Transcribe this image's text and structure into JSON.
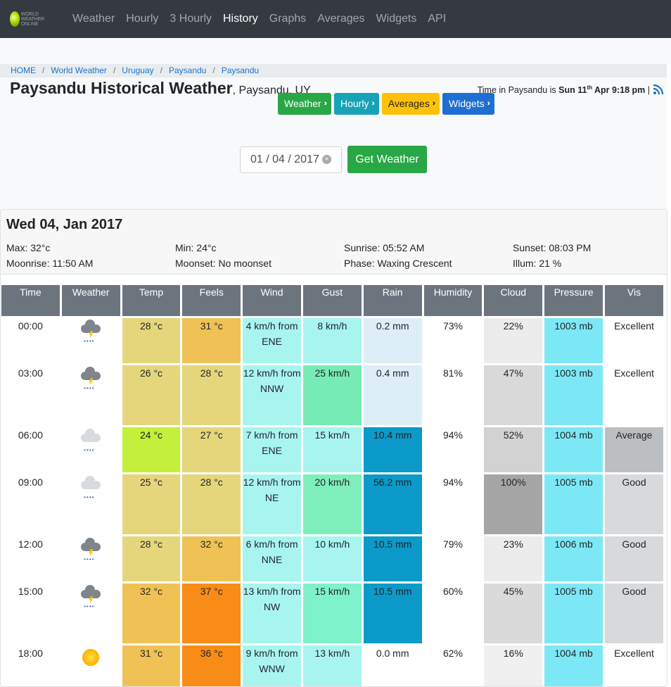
{
  "nav": {
    "logo_text": "WORLD WEATHER ONLINE",
    "items": [
      "Weather",
      "Hourly",
      "3 Hourly",
      "History",
      "Graphs",
      "Averages",
      "Widgets",
      "API"
    ],
    "active": "History"
  },
  "breadcrumb": [
    "HOME",
    "World Weather",
    "Uruguay",
    "Paysandu",
    "Paysandu"
  ],
  "header": {
    "title": "Paysandu Historical Weather",
    "subtitle": ", Paysandu, UY",
    "time_prefix": "Time in Paysandu is ",
    "time_day": "Sun 11",
    "time_suffix_sup": "th",
    "time_rest": " Apr 9:18 pm",
    "time_pipe": " |"
  },
  "buttons": [
    "Weather",
    "Hourly",
    "Averages",
    "Widgets"
  ],
  "date_input": {
    "value": "01 / 04 / 2017"
  },
  "get_weather_label": "Get Weather",
  "day": {
    "title": "Wed 04, Jan 2017",
    "max": "Max: 32°c",
    "min": "Min: 24°c",
    "sunrise": "Sunrise: 05:52 AM",
    "sunset": "Sunset: 08:03 PM",
    "moonrise": "Moonrise: 11:50 AM",
    "moonset": "Moonset: No moonset",
    "phase": "Phase: Waxing Crescent",
    "illum": "Illum: 21 %"
  },
  "columns": [
    "Time",
    "Weather",
    "Temp",
    "Feels",
    "Wind",
    "Gust",
    "Rain",
    "Humidity",
    "Cloud",
    "Pressure",
    "Vis"
  ],
  "rows": [
    {
      "time": "00:00",
      "icon": "thunder-rain-icon",
      "temp": "28 °c",
      "feels": "31 °c",
      "wind": "4 km/h from ENE",
      "gust": "8 km/h",
      "rain": "0.2 mm",
      "humidity": "73%",
      "cloud": "22%",
      "pressure": "1003 mb",
      "vis": "Excellent",
      "temp_color": "#e5d67c",
      "feels_color": "#f0c255",
      "wind_color": "#a8f5f0",
      "gust_color": "#a8f5f0",
      "rain_color": "#ddeef7",
      "cloud_color": "#ececec",
      "vis_color": "#ffffff"
    },
    {
      "time": "03:00",
      "icon": "thunder-rain-icon",
      "temp": "26 °c",
      "feels": "28 °c",
      "wind": "12 km/h from NNW",
      "gust": "25 km/h",
      "rain": "0.4 mm",
      "humidity": "81%",
      "cloud": "47%",
      "pressure": "1003 mb",
      "vis": "Excellent",
      "temp_color": "#e5d67c",
      "feels_color": "#e5d67c",
      "wind_color": "#a8f5f0",
      "gust_color": "#76ecb4",
      "rain_color": "#ddeef7",
      "cloud_color": "#d9d9d9",
      "vis_color": "#ffffff"
    },
    {
      "time": "06:00",
      "icon": "heavy-rain-icon",
      "temp": "24 °c",
      "feels": "27 °c",
      "wind": "7 km/h from ENE",
      "gust": "15 km/h",
      "rain": "10.4 mm",
      "humidity": "94%",
      "cloud": "52%",
      "pressure": "1004 mb",
      "vis": "Average",
      "temp_color": "#c4ef3a",
      "feels_color": "#e5d67c",
      "wind_color": "#a8f5f0",
      "gust_color": "#a8f5f0",
      "rain_color": "#0b9ac9",
      "cloud_color": "#d2d2d2",
      "vis_color": "#bcbfc1"
    },
    {
      "time": "09:00",
      "icon": "heavy-rain-icon",
      "temp": "25 °c",
      "feels": "28 °c",
      "wind": "12 km/h from NE",
      "gust": "20 km/h",
      "rain": "56.2 mm",
      "humidity": "94%",
      "cloud": "100%",
      "pressure": "1005 mb",
      "vis": "Good",
      "temp_color": "#e5d67c",
      "feels_color": "#e5d67c",
      "wind_color": "#a8f5f0",
      "gust_color": "#7eefba",
      "rain_color": "#0b9ac9",
      "cloud_color": "#a5a5a5",
      "vis_color": "#d8d9da"
    },
    {
      "time": "12:00",
      "icon": "thunder-rain-icon",
      "temp": "28 °c",
      "feels": "32 °c",
      "wind": "6 km/h from NNE",
      "gust": "10 km/h",
      "rain": "10.5 mm",
      "humidity": "79%",
      "cloud": "23%",
      "pressure": "1006 mb",
      "vis": "Good",
      "temp_color": "#e5d67c",
      "feels_color": "#f0c255",
      "wind_color": "#a8f5f0",
      "gust_color": "#a8f5f0",
      "rain_color": "#0b9ac9",
      "cloud_color": "#ececec",
      "vis_color": "#d8d9da"
    },
    {
      "time": "15:00",
      "icon": "thunder-rain-icon",
      "temp": "32 °c",
      "feels": "37 °c",
      "wind": "13 km/h from NW",
      "gust": "15 km/h",
      "rain": "10.5 mm",
      "humidity": "60%",
      "cloud": "45%",
      "pressure": "1005 mb",
      "vis": "Good",
      "temp_color": "#f0c255",
      "feels_color": "#f98c16",
      "wind_color": "#a8f5f0",
      "gust_color": "#7ef2ca",
      "rain_color": "#0b9ac9",
      "cloud_color": "#dadada",
      "vis_color": "#d8d9da"
    },
    {
      "time": "18:00",
      "icon": "sun-icon",
      "temp": "31 °c",
      "feels": "36 °c",
      "wind": "9 km/h from WNW",
      "gust": "13 km/h",
      "rain": "0.0 mm",
      "humidity": "62%",
      "cloud": "16%",
      "pressure": "1004 mb",
      "vis": "Excellent",
      "temp_color": "#f0c255",
      "feels_color": "#f98c16",
      "wind_color": "#a8f5f0",
      "gust_color": "#a8f5f0",
      "rain_color": "#ffffff",
      "cloud_color": "#f0f0f0",
      "vis_color": "#ffffff"
    }
  ]
}
